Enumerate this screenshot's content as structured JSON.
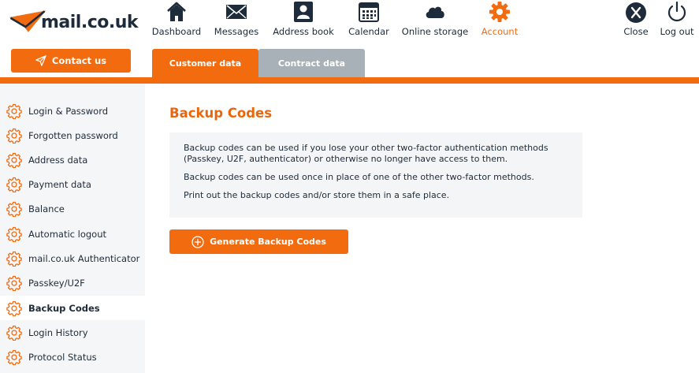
{
  "brand": {
    "name": "mail.co.uk",
    "accent": "#f26b0f",
    "text_color": "#1d2b3a",
    "inactive_tab": "#a8b0b8"
  },
  "contact_button": {
    "label": "Contact us",
    "icon": "paper-plane-icon"
  },
  "nav": [
    {
      "id": "dashboard",
      "label": "Dashboard",
      "icon": "home-icon"
    },
    {
      "id": "messages",
      "label": "Messages",
      "icon": "envelope-icon"
    },
    {
      "id": "address_book",
      "label": "Address book",
      "icon": "contact-card-icon"
    },
    {
      "id": "calendar",
      "label": "Calendar",
      "icon": "calendar-icon"
    },
    {
      "id": "online_storage",
      "label": "Online storage",
      "icon": "cloud-icon"
    },
    {
      "id": "account",
      "label": "Account",
      "icon": "gear-icon",
      "active": true
    },
    {
      "id": "close",
      "label": "Close",
      "icon": "close-x-icon"
    },
    {
      "id": "logout",
      "label": "Log out",
      "icon": "power-icon"
    }
  ],
  "tabs": [
    {
      "label": "Customer data",
      "active": true
    },
    {
      "label": "Contract data",
      "active": false
    }
  ],
  "sidebar": {
    "items": [
      {
        "label": "Login & Password"
      },
      {
        "label": "Forgotten password"
      },
      {
        "label": "Address data"
      },
      {
        "label": "Payment data"
      },
      {
        "label": "Balance"
      },
      {
        "label": "Automatic logout"
      },
      {
        "label": "mail.co.uk Authenticator"
      },
      {
        "label": "Passkey/U2F"
      },
      {
        "label": "Backup Codes",
        "active": true
      },
      {
        "label": "Login History"
      },
      {
        "label": "Protocol Status"
      }
    ]
  },
  "main": {
    "title": "Backup Codes",
    "info": [
      "Backup codes can be used if you lose your other two-factor authentication methods (Passkey, U2F, authenticator) or otherwise no longer have access to them.",
      "Backup codes can be used once in place of one of the other two-factor methods.",
      "Print out the backup codes and/or store them in a safe place."
    ],
    "generate_button": {
      "label": "Generate Backup Codes",
      "icon": "plus-circle-icon"
    }
  }
}
